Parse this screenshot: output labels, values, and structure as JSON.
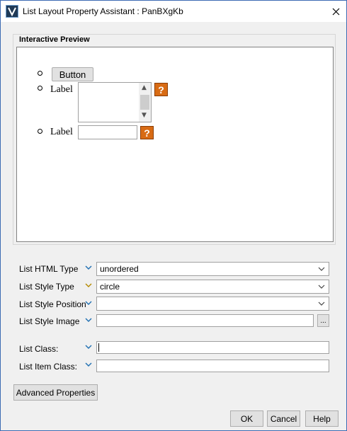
{
  "window": {
    "title": "List Layout Property Assistant : PanBXgKb"
  },
  "preview": {
    "group_label": "Interactive Preview",
    "button_label": "Button",
    "label1": "Label",
    "label2": "Label",
    "help_glyph": "?"
  },
  "properties": {
    "list_html_type": {
      "label": "List HTML Type",
      "value": "unordered"
    },
    "list_style_type": {
      "label": "List Style Type",
      "value": "circle"
    },
    "list_style_position": {
      "label": "List Style Position",
      "value": ""
    },
    "list_style_image": {
      "label": "List Style Image",
      "value": "",
      "browse_label": "..."
    },
    "list_class": {
      "label": "List Class:",
      "value": ""
    },
    "list_item_class": {
      "label": "List Item Class:",
      "value": ""
    }
  },
  "buttons": {
    "advanced": "Advanced Properties",
    "ok": "OK",
    "cancel": "Cancel",
    "help": "Help"
  },
  "icons": {
    "app": "app-logo-icon",
    "close": "close-icon",
    "expand": "chevron-down-icon",
    "help": "help-icon"
  },
  "colors": {
    "chevron_default": "#1f6fb2",
    "chevron_active": "#b58a00",
    "help_icon": "#d86b14"
  }
}
